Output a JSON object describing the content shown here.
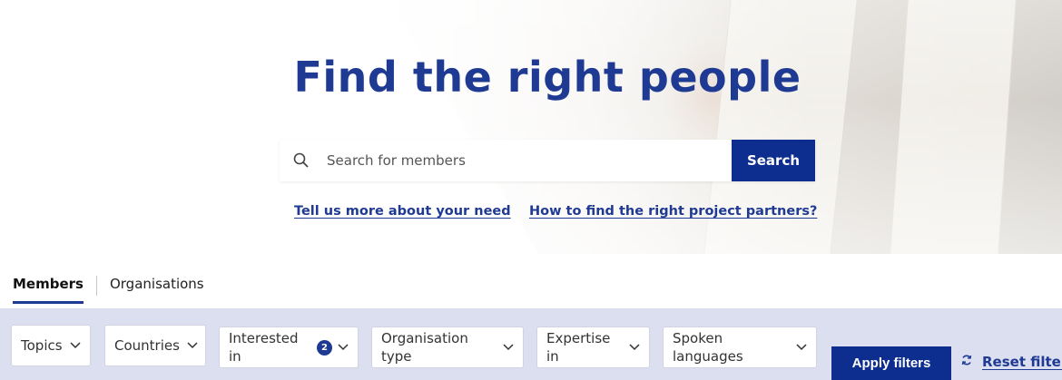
{
  "hero": {
    "title": "Find the right people",
    "search": {
      "placeholder": "Search for members",
      "button_label": "Search"
    },
    "links": [
      "Tell us more about your need",
      "How to find the right project partners?"
    ]
  },
  "tabs": [
    {
      "label": "Members",
      "active": true
    },
    {
      "label": "Organisations",
      "active": false
    }
  ],
  "filters": [
    {
      "label": "Topics"
    },
    {
      "label": "Countries"
    },
    {
      "label_line1": "Interested",
      "label_line2": "in",
      "badge": "2"
    },
    {
      "label_line1": "Organisation",
      "label_line2": "type"
    },
    {
      "label_line1": "Expertise",
      "label_line2": "in"
    },
    {
      "label_line1": "Spoken",
      "label_line2": "languages"
    }
  ],
  "actions": {
    "apply_label": "Apply filters",
    "reset_label": "Reset filters"
  },
  "colors": {
    "brand": "#1f3a93",
    "button": "#0d2e8e",
    "filter_bar": "#dcdff0"
  }
}
